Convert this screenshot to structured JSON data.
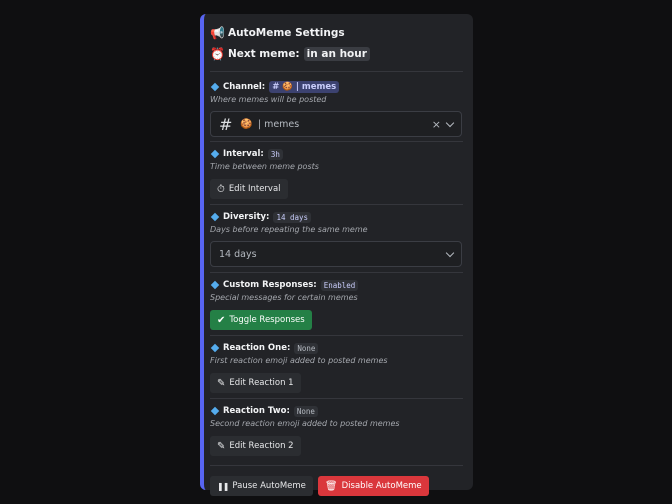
{
  "header": {
    "title_emoji": "📢",
    "title": "AutoMeme Settings",
    "next_emoji": "⏰",
    "next_label": "Next meme:",
    "next_value": "in an hour"
  },
  "channel": {
    "label": "Channel:",
    "chip": "# 🍪 | memes",
    "hint": "Where memes will be posted",
    "select_hash": "#",
    "select_emoji": "🍪",
    "select_value": "| memes",
    "clear_icon": "×"
  },
  "interval": {
    "label": "Interval:",
    "value": "3h",
    "hint": "Time between meme posts",
    "button": "Edit Interval",
    "button_icon": "⏱"
  },
  "diversity": {
    "label": "Diversity:",
    "value": "14 days",
    "hint": "Days before repeating the same meme",
    "select_value": "14 days"
  },
  "custom_responses": {
    "label": "Custom Responses:",
    "value": "Enabled",
    "hint": "Special messages for certain memes",
    "button": "Toggle Responses",
    "button_icon": "✔"
  },
  "reaction_one": {
    "label": "Reaction One:",
    "value": "None",
    "hint": "First reaction emoji added to posted memes",
    "button": "Edit Reaction 1",
    "button_icon": "✎"
  },
  "reaction_two": {
    "label": "Reaction Two:",
    "value": "None",
    "hint": "Second reaction emoji added to posted memes",
    "button": "Edit Reaction 2",
    "button_icon": "✎"
  },
  "footer": {
    "pause": "Pause AutoMeme",
    "pause_icon": "❚❚",
    "disable": "Disable AutoMeme",
    "disable_icon": "🗑"
  },
  "colors": {
    "accent": "#5865f2",
    "green": "#248046",
    "red": "#da373c",
    "diamond": "#55acee"
  }
}
